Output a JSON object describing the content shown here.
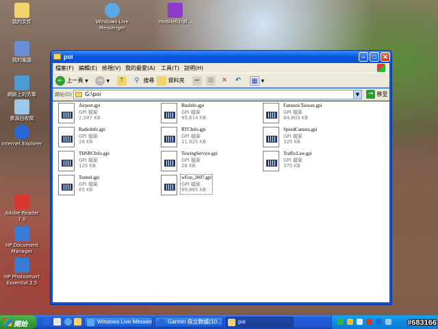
{
  "desktop_icons": [
    {
      "label": "我的文件",
      "color": "#f3d36b"
    },
    {
      "label": "我的電腦",
      "color": "#6a8fd8"
    },
    {
      "label": "網路上的芳鄰",
      "color": "#4b9ad6"
    },
    {
      "label": "資源回收筒",
      "color": "#9ec7e8"
    },
    {
      "label": "Internet Explorer",
      "color": "#2a67d4"
    },
    {
      "label": "Adobe Reader 7.0",
      "color": "#d9372b"
    },
    {
      "label": "HP Document Manager",
      "color": "#3a7bd5"
    },
    {
      "label": "HP Photosmart Essential 2.5",
      "color": "#3a7bd5"
    },
    {
      "label": "Windows Live Messenger",
      "color": "#5aa9e6"
    },
    {
      "label": "mobile01-3f...",
      "color": "#8a3cc8"
    }
  ],
  "window": {
    "title": "poi",
    "min": "–",
    "max": "□",
    "close": "✕"
  },
  "menu": [
    "檔案(F)",
    "編輯(E)",
    "檢視(V)",
    "我的最愛(A)",
    "工具(T)",
    "說明(H)"
  ],
  "toolbar": {
    "back": "上一頁",
    "search": "搜尋",
    "folders": "資料夾"
  },
  "address": {
    "label": "網址(D)",
    "value": "G:\\poi",
    "go": "移至"
  },
  "files": [
    {
      "name": "Airport.gpi",
      "type": "GPI 檔案",
      "size": "2,387 KB"
    },
    {
      "name": "BusInfo.gpi",
      "type": "GPI 檔案",
      "size": "95,614 KB"
    },
    {
      "name": "FantasticTaiwan.gpi",
      "type": "GPI 檔案",
      "size": "84,803 KB"
    },
    {
      "name": "RadioInfo.gpi",
      "type": "GPI 檔案",
      "size": "28 KB"
    },
    {
      "name": "RTCInfo.gpi",
      "type": "GPI 檔案",
      "size": "11,825 KB"
    },
    {
      "name": "SpeedCamera.gpi",
      "type": "GPI 檔案",
      "size": "325 KB"
    },
    {
      "name": "THSRCInfo.gpi",
      "type": "GPI 檔案",
      "size": "125 KB"
    },
    {
      "name": "TowingService.gpi",
      "type": "GPI 檔案",
      "size": "28 KB"
    },
    {
      "name": "TrafficLaw.gpi",
      "type": "GPI 檔案",
      "size": "375 KB"
    },
    {
      "name": "Tunnel.gpi",
      "type": "GPI 檔案",
      "size": "65 KB"
    },
    {
      "name": "wFun_2007.gpi",
      "type": "GPI 檔案",
      "size": "89,865 KB"
    }
  ],
  "taskbar": {
    "start": "開始",
    "tasks": [
      "Windows Live Messen...",
      "Garmin 自立數據(10...",
      "poi"
    ],
    "watermark": "#683166"
  },
  "colors": {
    "titlebar": "#0a5ae0",
    "start": "#379c37",
    "taskbar": "#245edb"
  }
}
